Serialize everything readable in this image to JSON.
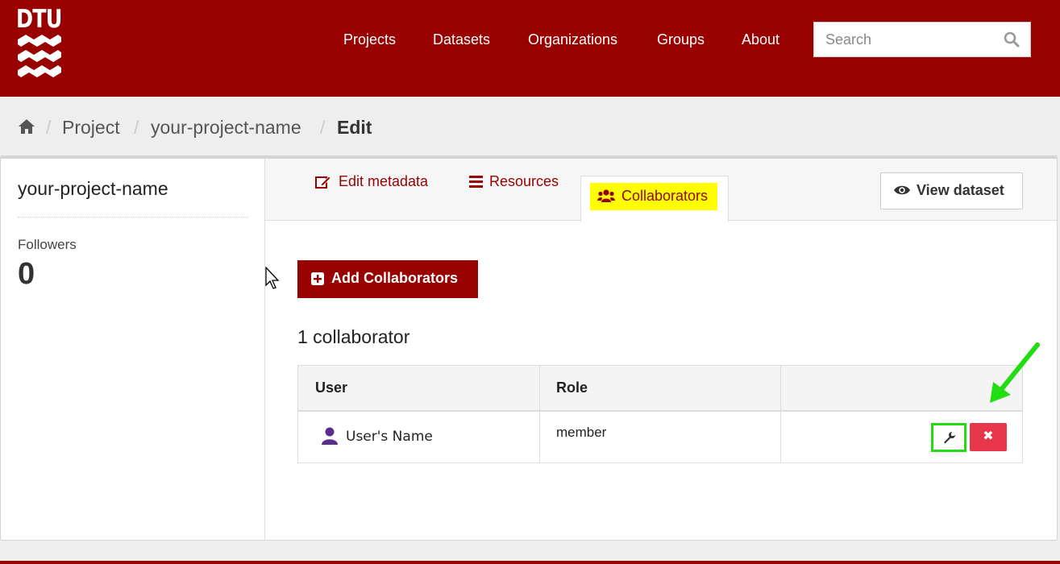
{
  "header": {
    "logo_text": "DTU",
    "nav": [
      "Projects",
      "Datasets",
      "Organizations",
      "Groups",
      "About"
    ],
    "search": {
      "placeholder": "Search"
    }
  },
  "breadcrumb": {
    "items": [
      "Project",
      "your-project-name",
      "Edit"
    ]
  },
  "sidebar": {
    "title": "your-project-name",
    "followers_label": "Followers",
    "followers_count": "0"
  },
  "tabs": {
    "edit_metadata": "Edit metadata",
    "resources": "Resources",
    "collaborators": "Collaborators",
    "view_dataset": "View dataset"
  },
  "main": {
    "add_button": "Add Collaborators",
    "count_heading": "1 collaborator",
    "table": {
      "headers": [
        "User",
        "Role",
        ""
      ],
      "rows": [
        {
          "user": "User's Name",
          "role": "member"
        }
      ]
    },
    "delete_glyph": "✖"
  },
  "colors": {
    "brand": "#990000",
    "highlight": "#ffff00",
    "annotation": "#22dd11",
    "danger": "#e8364a"
  }
}
